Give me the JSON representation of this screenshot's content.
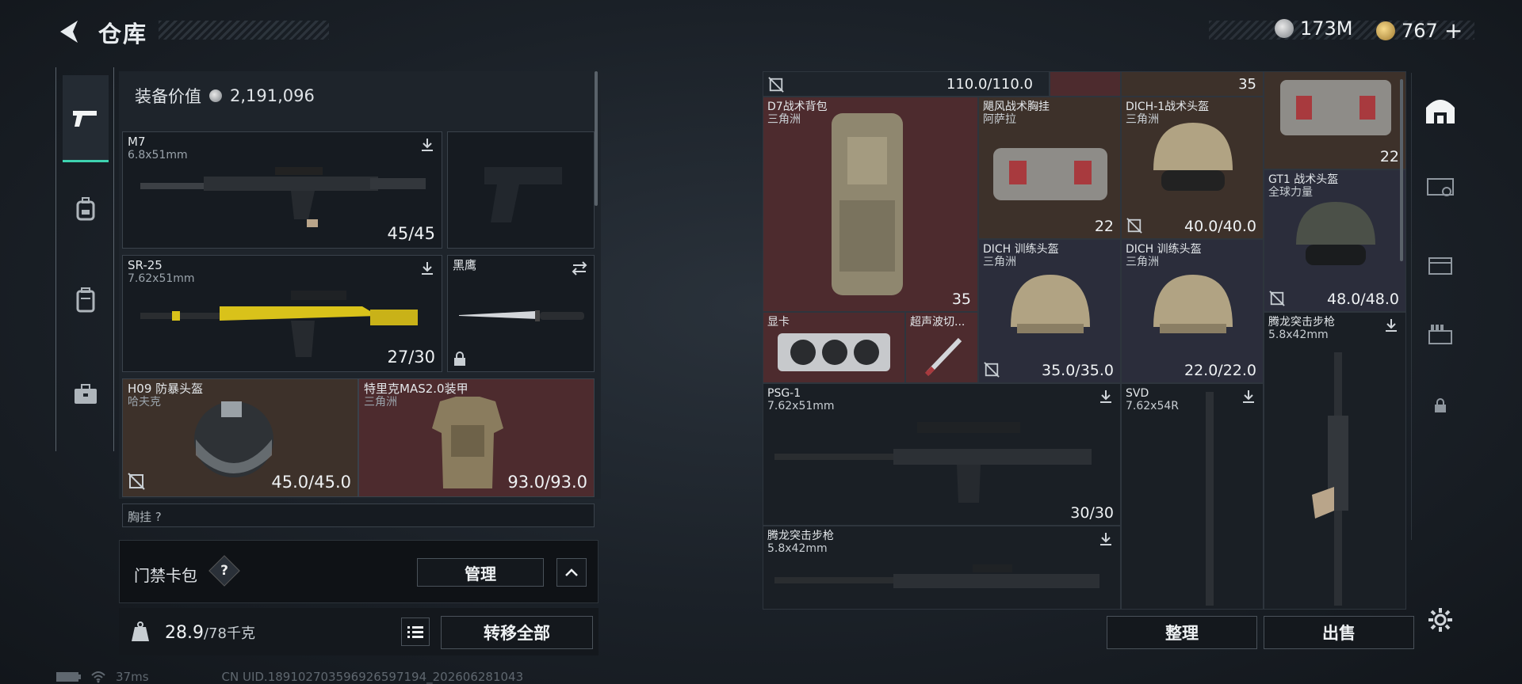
{
  "header": {
    "title": "仓库",
    "currency1": "173M",
    "currency2": "767",
    "currency2_plus": "+"
  },
  "colors": {
    "accent": "#3ed3b0",
    "red_slot": "#4d2b2e",
    "brown_slot": "#3d312a"
  },
  "left_nav": [
    "pistol-icon",
    "backpack-icon",
    "locker-icon",
    "briefcase-icon"
  ],
  "loadout": {
    "equip_value_label": "装备价值",
    "equip_value": "2,191,096",
    "slots": [
      {
        "name": "M7",
        "sub": "6.8x51mm",
        "count": "45/45"
      },
      {
        "name": "SR-25",
        "sub": "7.62x51mm",
        "count": "27/30"
      },
      {
        "name": "黑鹰",
        "sub": ""
      },
      {
        "name": "H09 防暴头盔",
        "sub": "哈夫克",
        "count": "45.0/45.0"
      },
      {
        "name": "特里克MAS2.0装甲",
        "sub": "三角洲",
        "count": "93.0/93.0"
      }
    ],
    "next_section": "胸挂 ?"
  },
  "card_pack": {
    "label": "门禁卡包",
    "help": "?",
    "manage": "管理"
  },
  "weight": {
    "current": "28.9",
    "max": "/78千克",
    "transfer_all": "转移全部"
  },
  "status": {
    "ping": "37ms",
    "uid": "CN UID.18910270359692659719​4_202606281043"
  },
  "storage": {
    "top_row": {
      "durability": "110.0/110.0",
      "count1": "35"
    },
    "items": [
      {
        "name": "D7战术背包",
        "sub": "三角洲",
        "count": "35"
      },
      {
        "name": "飓风战术胸挂",
        "sub": "阿萨拉",
        "count": "22"
      },
      {
        "name": "DICH-1战术头盔",
        "sub": "三角洲",
        "count": "40.0/40.0"
      },
      {
        "name": "",
        "sub": "",
        "count": "22"
      },
      {
        "name": "GT1 战术头盔",
        "sub": "全球力量",
        "count": "48.0/48.0"
      },
      {
        "name": "DICH 训练头盔",
        "sub": "三角洲",
        "count": "35.0/35.0"
      },
      {
        "name": "DICH 训练头盔",
        "sub": "三角洲",
        "count": "22.0/22.0"
      },
      {
        "name": "显卡",
        "sub": ""
      },
      {
        "name": "超声波切...",
        "sub": ""
      },
      {
        "name": "腾龙突击步枪",
        "sub": "5.8x42mm"
      },
      {
        "name": "PSG-1",
        "sub": "7.62x51mm",
        "count": "30/30"
      },
      {
        "name": "SVD",
        "sub": "7.62x54R"
      },
      {
        "name": "腾龙突击步枪",
        "sub": "5.8x42mm"
      }
    ],
    "sort": "整理",
    "sell": "出售"
  }
}
